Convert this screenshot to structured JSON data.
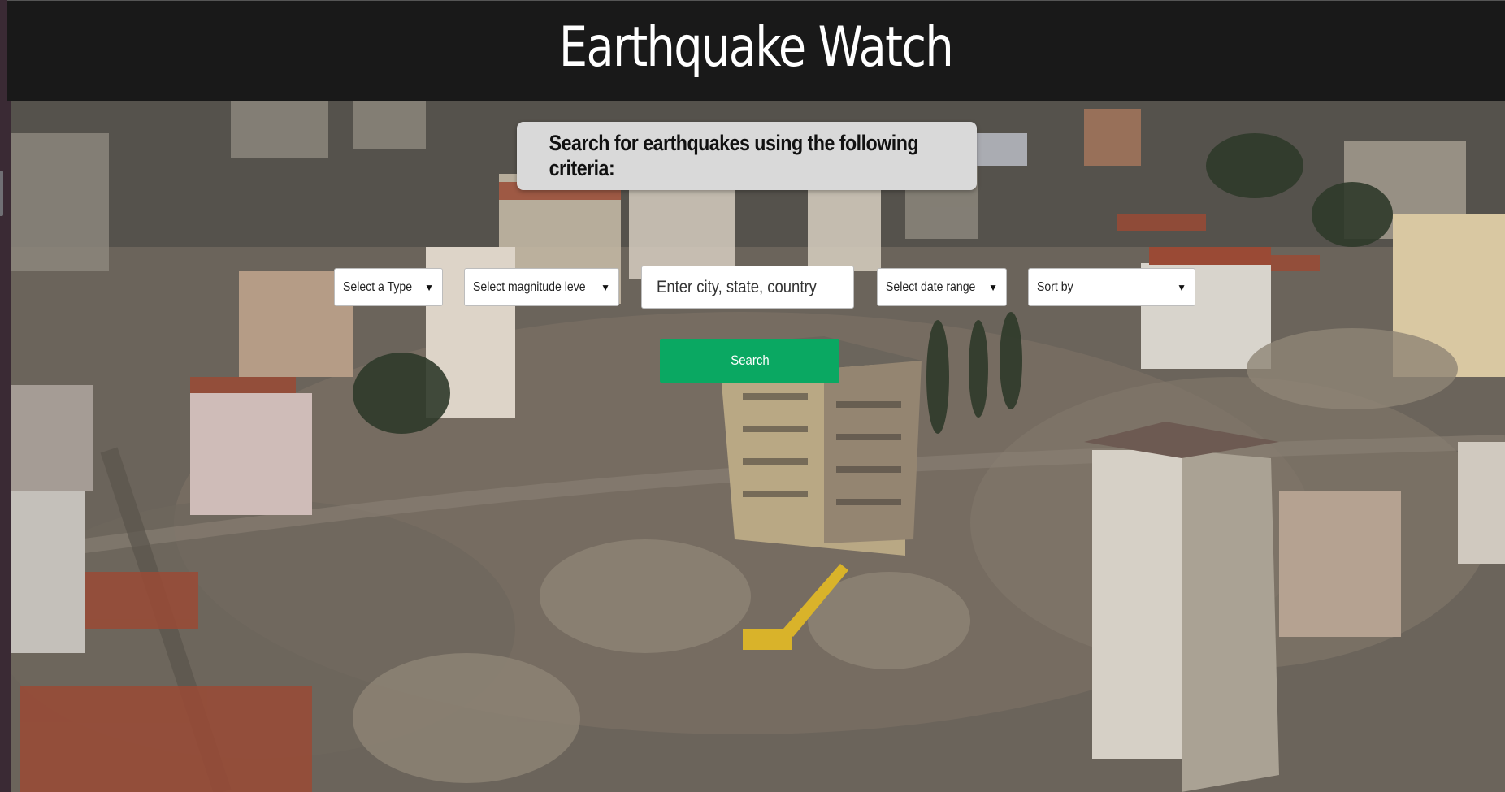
{
  "header": {
    "title": "Earthquake Watch"
  },
  "criteria": {
    "heading": "Search for earthquakes using the following criteria:"
  },
  "filters": {
    "type_label": "Select a Type",
    "magnitude_label": "Select magnitude level",
    "location_placeholder": "Enter city, state, country",
    "date_label": "Select date range",
    "sort_label": "Sort by"
  },
  "actions": {
    "search_label": "Search"
  },
  "colors": {
    "header_bg": "#191919",
    "search_button": "#0aa862",
    "criteria_box": "#d9d9d9"
  },
  "icons": {
    "dropdown": "chevron-down-icon"
  }
}
